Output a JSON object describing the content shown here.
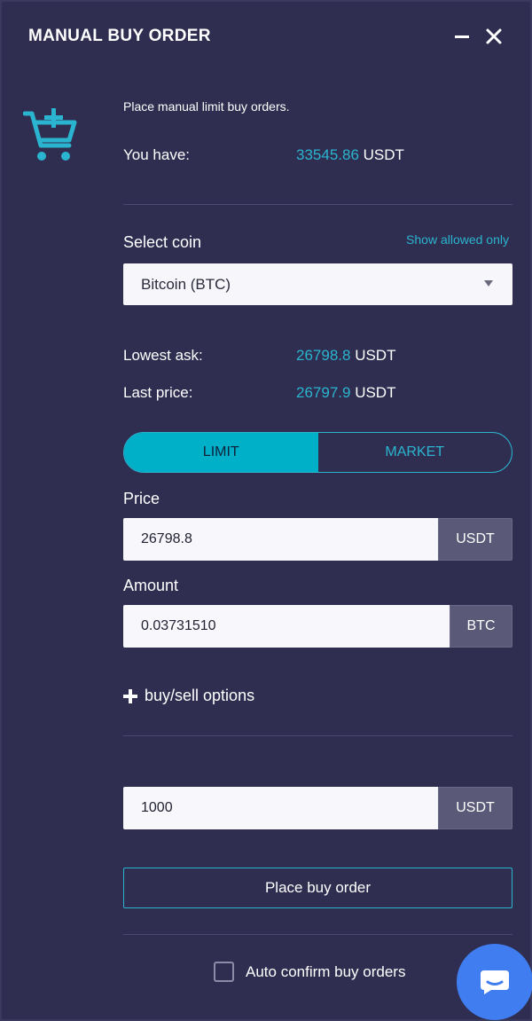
{
  "window": {
    "title": "MANUAL BUY ORDER",
    "minimize_icon": "minimize-icon",
    "close_icon": "close-icon"
  },
  "intro": "Place manual limit buy orders.",
  "balance": {
    "label": "You have:",
    "amount": "33545.86",
    "currency": "USDT"
  },
  "select_coin": {
    "label": "Select coin",
    "filter_link": "Show allowed only",
    "selected": "Bitcoin (BTC)"
  },
  "market": {
    "lowest_ask_label": "Lowest ask:",
    "lowest_ask_value": "26798.8",
    "lowest_ask_currency": "USDT",
    "last_price_label": "Last price:",
    "last_price_value": "26797.9",
    "last_price_currency": "USDT"
  },
  "order_type": {
    "options": [
      "LIMIT",
      "MARKET"
    ],
    "selected": "LIMIT"
  },
  "price": {
    "label": "Price",
    "value": "26798.8",
    "unit": "USDT"
  },
  "amount": {
    "label": "Amount",
    "value": "0.03731510",
    "unit": "BTC"
  },
  "options_toggle": "buy/sell options",
  "total": {
    "value": "1000",
    "unit": "USDT"
  },
  "place_button": "Place buy order",
  "auto_confirm": {
    "label": "Auto confirm buy orders",
    "checked": false
  },
  "colors": {
    "background": "#2f2e50",
    "accent": "#2bb4cf",
    "active_segment": "#00b0c9",
    "chat_button": "#3f7df0"
  },
  "icons": {
    "cart": "cart-plus-icon",
    "chat": "chat-icon"
  }
}
